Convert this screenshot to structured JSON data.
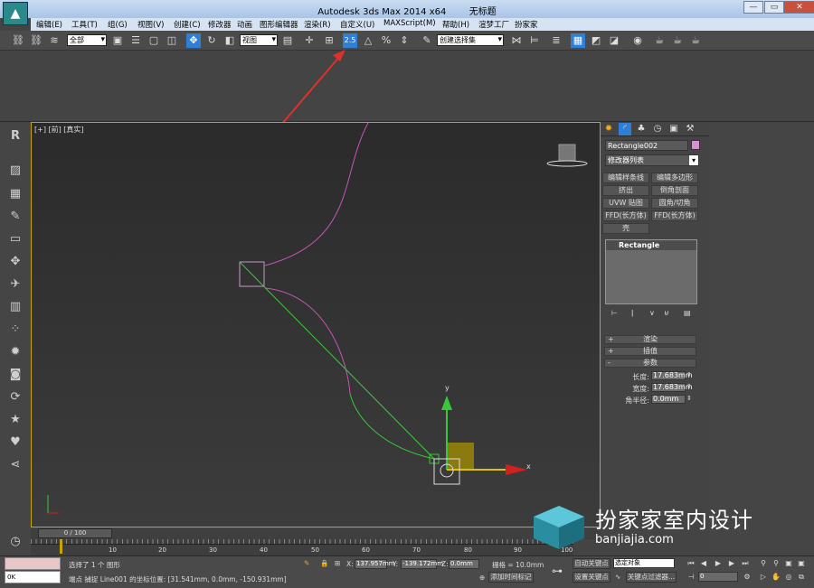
{
  "window": {
    "app_title": "Autodesk 3ds Max  2014 x64",
    "doc_title": "无标题",
    "minimize": "▭",
    "maximize": "▭",
    "close": "✕"
  },
  "menu": [
    "编辑(E)",
    "工具(T)",
    "组(G)",
    "视图(V)",
    "创建(C)",
    "修改器",
    "动画",
    "图形编辑器",
    "渲染(R)",
    "自定义(U)",
    "MAXScript(M)",
    "帮助(H)",
    "渲梦工厂",
    "扮家家"
  ],
  "toolbar": {
    "selection_filter": "全部",
    "ref_coord": "视图",
    "snap_label": "2.5",
    "named_selection": "创建选择集"
  },
  "viewport": {
    "label": "[+] [前] [真实]",
    "axis_x": "x",
    "axis_y": "y"
  },
  "command_panel": {
    "object_name": "Rectangle002",
    "object_color": "#d78fd8",
    "modifier_list": "修改器列表",
    "buttons": [
      "编辑样条线",
      "编辑多边形",
      "挤出",
      "倒角剖面",
      "UVW 贴图",
      "圆角/切角",
      "FFD(长方体)",
      "FFD(长方体)",
      "壳"
    ],
    "stack_item": "Rectangle",
    "rollouts": [
      {
        "sign": "+",
        "label": "渲染"
      },
      {
        "sign": "+",
        "label": "插值"
      },
      {
        "sign": "-",
        "label": "参数"
      }
    ],
    "params": [
      {
        "label": "长度:",
        "value": "17.683mm"
      },
      {
        "label": "宽度:",
        "value": "17.683mm"
      },
      {
        "label": "角半径:",
        "value": "0.0mm"
      }
    ]
  },
  "timeline": {
    "slider": "0 / 100",
    "ticks": [
      "10",
      "20",
      "30",
      "40",
      "50",
      "60",
      "70",
      "80",
      "90",
      "100"
    ]
  },
  "status": {
    "input_text": "0K",
    "selected": "选择了 1 个 图形",
    "snap_info": "端点 捕捉 Line001 的坐标位置: [31.541mm, 0.0mm, -150.931mm]",
    "x_label": "X:",
    "x_value": "137.957mm",
    "y_label": "Y:",
    "y_value": "-139.172mm",
    "z_label": "Z:",
    "z_value": "0.0mm",
    "grid": "栅格 = 10.0mm",
    "add_time_tag": "添加时间标记",
    "auto_key": "自动关键点",
    "set_key": "设置关键点",
    "selection_dropdown": "选定对象",
    "key_filter": "关键点过滤器...",
    "frame": "0"
  },
  "watermark": {
    "cn": "扮家家室内设计",
    "en": "banjiajia.com"
  },
  "colors": {
    "viewport_border": "#c8a400",
    "spline_pink": "#c455b8",
    "spline_green": "#38c838",
    "arrow_red": "#e0302a"
  }
}
